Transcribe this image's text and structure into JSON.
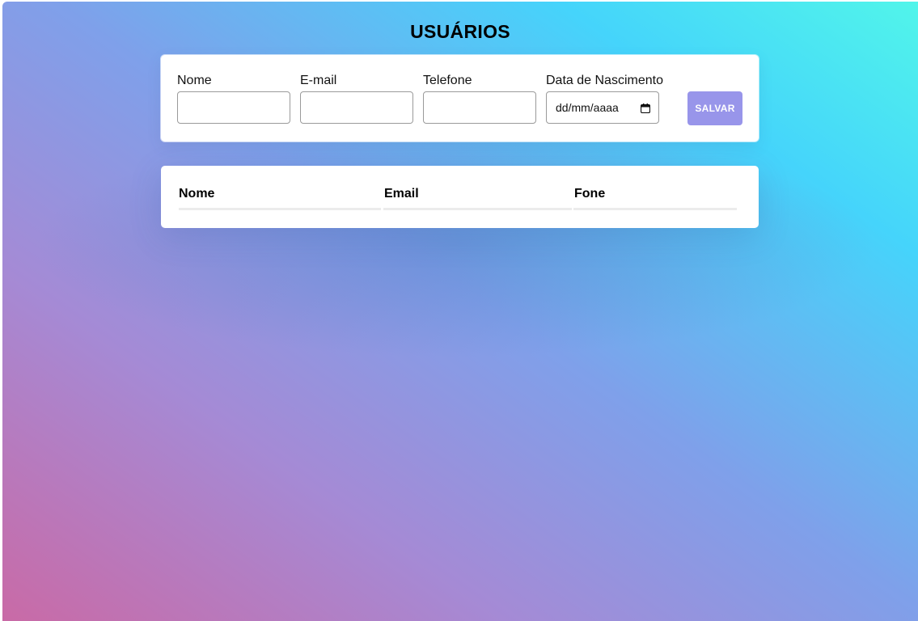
{
  "page": {
    "title": "USUÁRIOS"
  },
  "form": {
    "fields": [
      {
        "label": "Nome",
        "value": "",
        "placeholder": ""
      },
      {
        "label": "E-mail",
        "value": "",
        "placeholder": ""
      },
      {
        "label": "Telefone",
        "value": "",
        "placeholder": ""
      },
      {
        "label": "Data de Nascimento",
        "value": "dd/mm/aaaa",
        "icon": "calendar-icon"
      }
    ],
    "save_label": "SALVAR"
  },
  "table": {
    "columns": [
      "Nome",
      "Email",
      "Fone"
    ],
    "rows": []
  },
  "colors": {
    "button": "#9895ea",
    "gradient_start": "#c96aa6",
    "gradient_mid": "#7fa0ea",
    "gradient_end": "#51f5ea"
  }
}
